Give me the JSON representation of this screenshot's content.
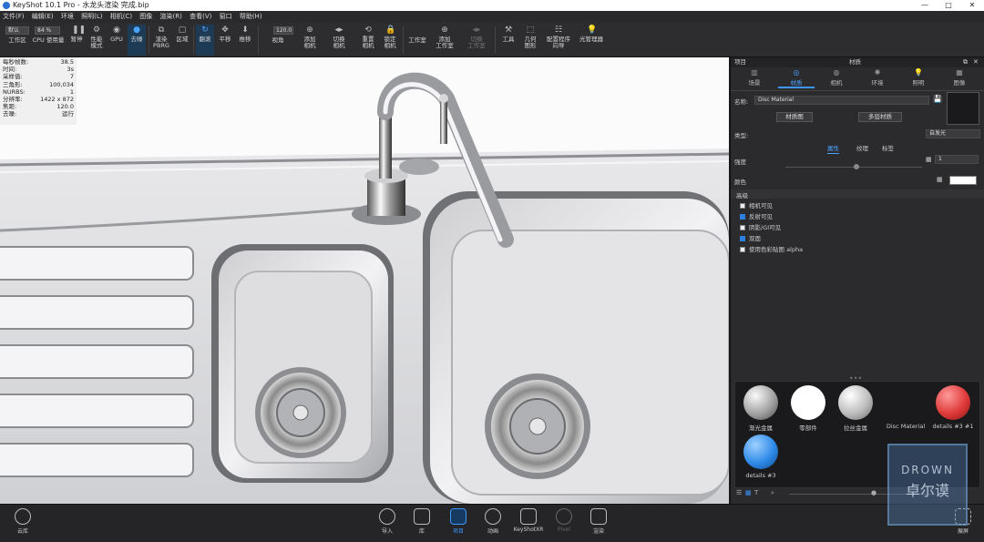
{
  "titlebar": {
    "title": "KeyShot 10.1 Pro  - 水龙头渲染 完成.bip",
    "min": "—",
    "max": "□",
    "close": "✕"
  },
  "menu": [
    "文件(F)",
    "编辑(E)",
    "环境",
    "照明(L)",
    "相机(C)",
    "图像",
    "渲染(R)",
    "查看(V)",
    "窗口",
    "帮助(H)"
  ],
  "toolbar": {
    "workspace_select": "默认",
    "percent_select": "84 %",
    "fov_value": "120.0",
    "items": [
      {
        "label": "工作区",
        "icon": "workspace-icon"
      },
      {
        "label": "CPU 使用量",
        "icon": "cpu-icon"
      },
      {
        "label": "暂停",
        "icon": "pause-icon"
      },
      {
        "label": "性能\n模式",
        "icon": "performance-icon"
      },
      {
        "label": "GPU",
        "icon": "gpu-icon"
      },
      {
        "label": "去噪",
        "icon": "denoise-icon"
      },
      {
        "label": "渲染\nPBRG",
        "icon": "render-region-icon"
      },
      {
        "label": "区域",
        "icon": "region-icon"
      },
      {
        "label": "翻滚",
        "icon": "tumble-icon"
      },
      {
        "label": "平移",
        "icon": "pan-icon"
      },
      {
        "label": "推移",
        "icon": "dolly-icon"
      },
      {
        "label": "视角",
        "icon": "fov-icon"
      },
      {
        "label": "添加\n相机",
        "icon": "add-camera-icon"
      },
      {
        "label": "切换\n相机",
        "icon": "switch-camera-icon"
      },
      {
        "label": "重置\n相机",
        "icon": "reset-camera-icon"
      },
      {
        "label": "锁定\n相机",
        "icon": "lock-camera-icon"
      },
      {
        "label": "工作室",
        "icon": "studio-icon"
      },
      {
        "label": "添加\n工作室",
        "icon": "add-studio-icon"
      },
      {
        "label": "切换\n工作室",
        "icon": "switch-studio-icon"
      },
      {
        "label": "工具",
        "icon": "tools-icon"
      },
      {
        "label": "几何\n图形",
        "icon": "geometry-icon"
      },
      {
        "label": "配置程序\n向导",
        "icon": "configurator-icon"
      },
      {
        "label": "光管理器",
        "icon": "light-manager-icon"
      }
    ]
  },
  "stats": [
    {
      "k": "每秒帧数:",
      "v": "38.5"
    },
    {
      "k": "时间:",
      "v": "3s"
    },
    {
      "k": "采样值:",
      "v": "7"
    },
    {
      "k": "三角形:",
      "v": "100,034"
    },
    {
      "k": "NURBS:",
      "v": "1"
    },
    {
      "k": "分辨率:",
      "v": "1422 x 872"
    },
    {
      "k": "焦距:",
      "v": "120.0"
    },
    {
      "k": "去噪:",
      "v": "运行"
    }
  ],
  "panel": {
    "header_left": "项目",
    "header_title": "材质",
    "tabs": [
      {
        "label": "场景",
        "icon": "scene-icon"
      },
      {
        "label": "材质",
        "icon": "material-icon"
      },
      {
        "label": "相机",
        "icon": "camera-icon"
      },
      {
        "label": "环境",
        "icon": "environment-icon"
      },
      {
        "label": "照明",
        "icon": "lighting-icon"
      },
      {
        "label": "图像",
        "icon": "image-icon"
      }
    ],
    "name_label": "名称:",
    "name_value": "Disc Material",
    "material_graph_btn": "材质图",
    "multi_layer_btn": "多层材质",
    "type_label": "类型:",
    "type_value": "自发光",
    "subtabs": [
      "属性",
      "纹理",
      "标签"
    ],
    "intensity_label": "强度",
    "intensity_value": "1",
    "color_label": "颜色",
    "advanced_label": "高级",
    "options": [
      {
        "label": "相机可见",
        "checked": false
      },
      {
        "label": "反射可见",
        "checked": true
      },
      {
        "label": "阴影/GI可见",
        "checked": false
      },
      {
        "label": "双面",
        "checked": true
      },
      {
        "label": "使用色彩贴图 alpha",
        "checked": false
      }
    ],
    "library": [
      {
        "label": "渐光金属",
        "color": "#b9b9b9"
      },
      {
        "label": "零部件",
        "color": "#ffffff"
      },
      {
        "label": "拉丝金属",
        "color": "#c8c8c8"
      },
      {
        "label": "Disc Material",
        "color": "#1a1a1c"
      },
      {
        "label": "details #3 #1",
        "color": "#e03a3a"
      },
      {
        "label": "details #3",
        "color": "#2f8be8"
      }
    ]
  },
  "bottom": {
    "cloud": "云库",
    "items": [
      {
        "label": "导入",
        "icon": "import-icon"
      },
      {
        "label": "库",
        "icon": "library-icon"
      },
      {
        "label": "项目",
        "icon": "project-icon"
      },
      {
        "label": "动画",
        "icon": "animation-icon"
      },
      {
        "label": "KeyShotXR",
        "icon": "keyshotxr-icon"
      },
      {
        "label": "Pixel",
        "icon": "pixel-icon"
      },
      {
        "label": "渲染",
        "icon": "render-icon"
      }
    ],
    "fullscreen": "展屏"
  },
  "watermark": {
    "top": "DROWN",
    "bottom": "卓尔谟"
  },
  "colors": {
    "accent": "#3d95ff",
    "viewport_bg": "#fbfbfb"
  }
}
